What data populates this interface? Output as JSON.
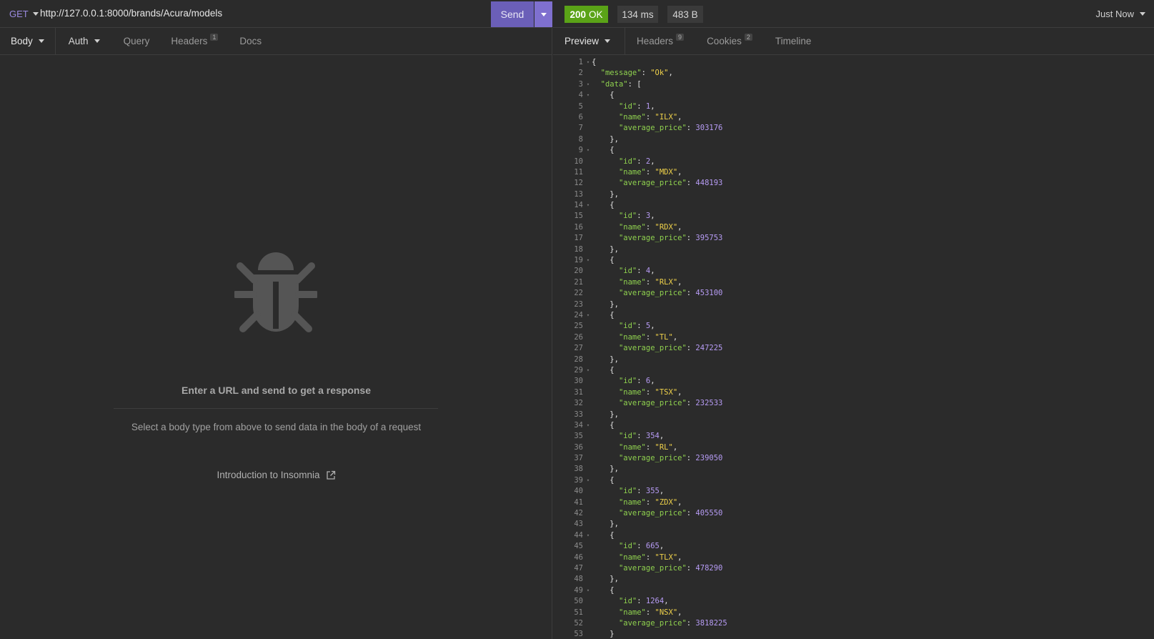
{
  "request": {
    "method": "GET",
    "url": "http://127.0.0.1:8000/brands/Acura/models",
    "send_label": "Send"
  },
  "request_tabs": {
    "body": "Body",
    "auth": "Auth",
    "query": "Query",
    "headers": "Headers",
    "headers_count": "1",
    "docs": "Docs"
  },
  "empty_state": {
    "title": "Enter a URL and send to get a response",
    "subtitle": "Select a body type from above to send data in the body of a request",
    "link": "Introduction to Insomnia"
  },
  "response": {
    "status_code": "200",
    "status_text": "OK",
    "time": "134 ms",
    "size": "483 B",
    "history": "Just Now",
    "colors": {
      "ok": "#5aa317",
      "send": "#6b5fb8",
      "keys": "#8fd14f",
      "strings": "#f0d24a",
      "numbers": "#b79cf5"
    }
  },
  "response_tabs": {
    "preview": "Preview",
    "headers": "Headers",
    "headers_count": "9",
    "cookies": "Cookies",
    "cookies_count": "2",
    "timeline": "Timeline"
  },
  "json_body": {
    "message": "Ok",
    "data": [
      {
        "id": 1,
        "name": "ILX",
        "average_price": 303176
      },
      {
        "id": 2,
        "name": "MDX",
        "average_price": 448193
      },
      {
        "id": 3,
        "name": "RDX",
        "average_price": 395753
      },
      {
        "id": 4,
        "name": "RLX",
        "average_price": 453100
      },
      {
        "id": 5,
        "name": "TL",
        "average_price": 247225
      },
      {
        "id": 6,
        "name": "TSX",
        "average_price": 232533
      },
      {
        "id": 354,
        "name": "RL",
        "average_price": 239050
      },
      {
        "id": 355,
        "name": "ZDX",
        "average_price": 405550
      },
      {
        "id": 665,
        "name": "TLX",
        "average_price": 478290
      },
      {
        "id": 1264,
        "name": "NSX",
        "average_price": 3818225
      }
    ]
  }
}
